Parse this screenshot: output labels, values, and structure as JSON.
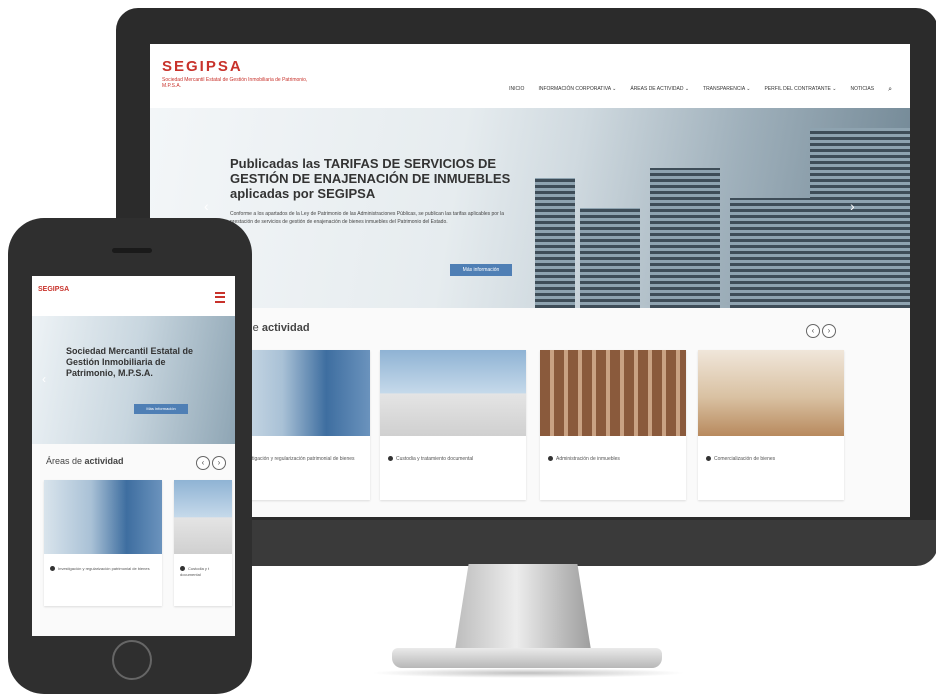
{
  "brand": {
    "name": "SEGIPSA",
    "tagline": "Sociedad Mercantil Estatal de Gestión Inmobiliaria de Patrimonio, M.P.S.A.",
    "accent_color": "#c8322b",
    "button_color": "#4f7fb5"
  },
  "desktop": {
    "nav": [
      "INICIO",
      "INFORMACIÓN CORPORATIVA ⌄",
      "ÁREAS DE ACTIVIDAD ⌄",
      "TRANSPARENCIA ⌄",
      "PERFIL DEL CONTRATANTE ⌄",
      "NOTICIAS"
    ],
    "search_icon": "search-icon",
    "hero": {
      "title": "Publicadas las TARIFAS DE SERVICIOS DE GESTIÓN DE ENAJENACIÓN DE INMUEBLES aplicadas por SEGIPSA",
      "body": "Conforme a los apartados de la Ley de Patrimonio de las Administraciones Públicas, se publican las tarifas aplicables por la prestación de servicios de gestión de enajenación de bienes inmuebles del Patrimonio del Estado.",
      "button": "Más información"
    },
    "areas": {
      "title_prefix": "s de ",
      "title_bold": "actividad",
      "cards": [
        {
          "caption": "Investigación y regularización patrimonial de bienes"
        },
        {
          "caption": "Custodia y tratamiento documental"
        },
        {
          "caption": "Administración de inmuebles"
        },
        {
          "caption": "Comercialización de bienes"
        }
      ]
    }
  },
  "mobile": {
    "logo": "SEGIPSA",
    "hero": {
      "title": "Sociedad Mercantil Estatal de Gestión Inmobiliaria de Patrimonio, M.P.S.A.",
      "button": "Más información"
    },
    "areas": {
      "title_prefix": "Áreas de ",
      "title_bold": "actividad",
      "cards": [
        {
          "caption": "Investigación y regularización patrimonial de bienes"
        },
        {
          "caption": "Custodia y t documental"
        }
      ]
    }
  }
}
